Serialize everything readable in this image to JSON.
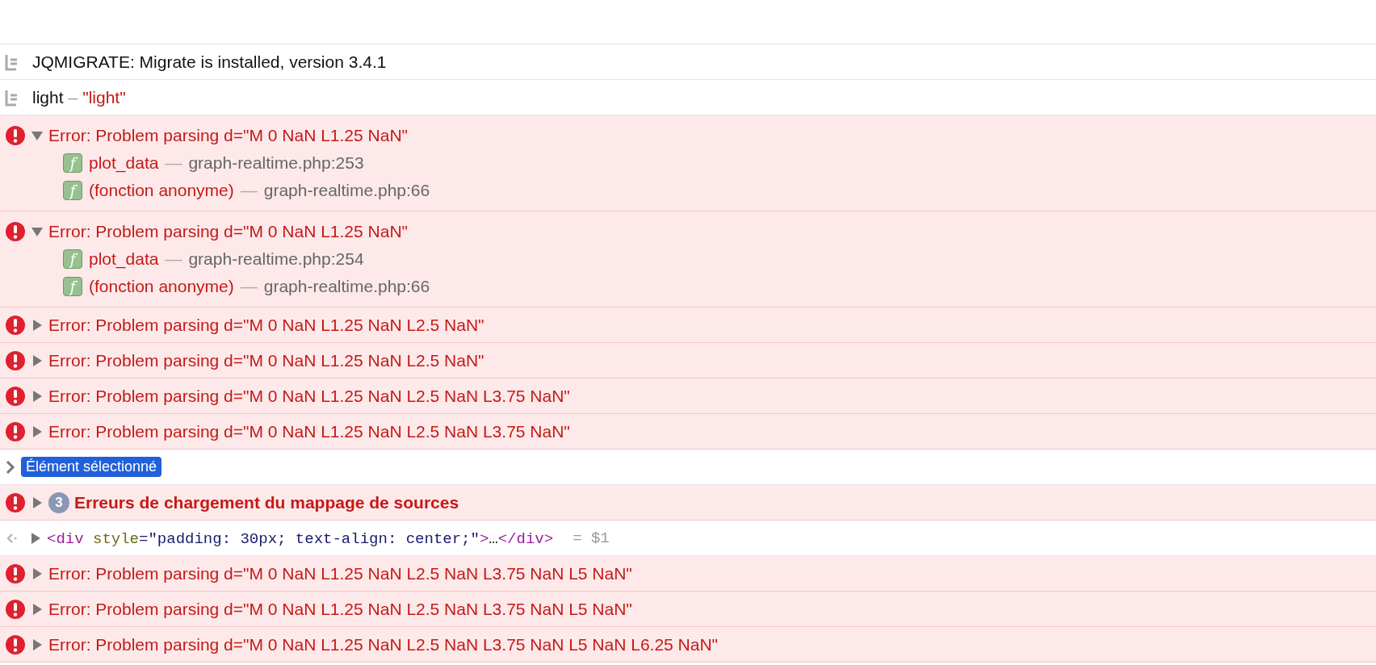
{
  "console": [
    {
      "kind": "log",
      "message": "JQMIGRATE: Migrate is installed, version 3.4.1"
    },
    {
      "kind": "log",
      "message": "light",
      "separator": "–",
      "value": "\"light\""
    },
    {
      "kind": "error",
      "expanded": true,
      "message": "Error: Problem parsing d=\"M 0 NaN L1.25 NaN\"",
      "frames": [
        {
          "badge": "f",
          "function": "plot_data",
          "separator": "—",
          "location": "graph-realtime.php:253"
        },
        {
          "badge": "f",
          "function": "(fonction anonyme)",
          "separator": "—",
          "location": "graph-realtime.php:66"
        }
      ]
    },
    {
      "kind": "error",
      "expanded": true,
      "message": "Error: Problem parsing d=\"M 0 NaN L1.25 NaN\"",
      "frames": [
        {
          "badge": "f",
          "function": "plot_data",
          "separator": "—",
          "location": "graph-realtime.php:254"
        },
        {
          "badge": "f",
          "function": "(fonction anonyme)",
          "separator": "—",
          "location": "graph-realtime.php:66"
        }
      ]
    },
    {
      "kind": "error",
      "expanded": false,
      "message": "Error: Problem parsing d=\"M 0 NaN L1.25 NaN L2.5 NaN\""
    },
    {
      "kind": "error",
      "expanded": false,
      "message": "Error: Problem parsing d=\"M 0 NaN L1.25 NaN L2.5 NaN\""
    },
    {
      "kind": "error",
      "expanded": false,
      "message": "Error: Problem parsing d=\"M 0 NaN L1.25 NaN L2.5 NaN L3.75 NaN\""
    },
    {
      "kind": "error",
      "expanded": false,
      "message": "Error: Problem parsing d=\"M 0 NaN L1.25 NaN L2.5 NaN L3.75 NaN\""
    },
    {
      "kind": "selection",
      "label": "Élément sélectionné"
    },
    {
      "kind": "error-group",
      "expanded": false,
      "count": "3",
      "message": "Erreurs de chargement du mappage de sources"
    },
    {
      "kind": "result",
      "expanded": false,
      "segments": [
        {
          "kind": "tag",
          "text": "<div"
        },
        {
          "kind": "attr",
          "text": " style"
        },
        {
          "kind": "value",
          "text": "=\"padding: 30px; text-align: center;\""
        },
        {
          "kind": "tag",
          "text": ">"
        },
        {
          "kind": "plain",
          "text": "…"
        },
        {
          "kind": "tag",
          "text": "</div>"
        }
      ],
      "ref": "= $1"
    },
    {
      "kind": "error",
      "expanded": false,
      "message": "Error: Problem parsing d=\"M 0 NaN L1.25 NaN L2.5 NaN L3.75 NaN L5 NaN\""
    },
    {
      "kind": "error",
      "expanded": false,
      "message": "Error: Problem parsing d=\"M 0 NaN L1.25 NaN L2.5 NaN L3.75 NaN L5 NaN\""
    },
    {
      "kind": "error",
      "expanded": false,
      "message": "Error: Problem parsing d=\"M 0 NaN L1.25 NaN L2.5 NaN L3.75 NaN L5 NaN L6.25 NaN\""
    }
  ]
}
